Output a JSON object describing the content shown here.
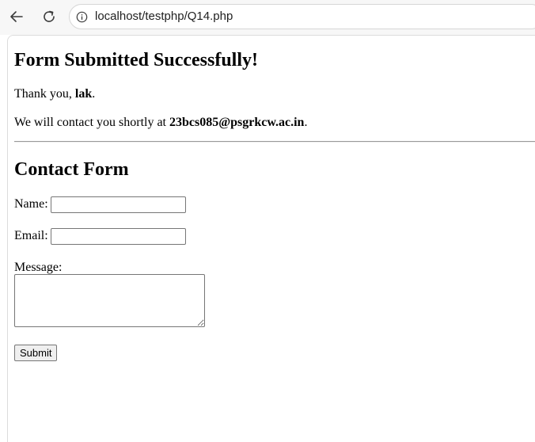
{
  "browser": {
    "url": "localhost/testphp/Q14.php"
  },
  "success": {
    "title": "Form Submitted Successfully!",
    "thank_prefix": "Thank you, ",
    "name": "lak",
    "thank_suffix": ".",
    "contact_prefix": "We will contact you shortly at ",
    "email": "23bcs085@psgrkcw.ac.in",
    "contact_suffix": "."
  },
  "form": {
    "title": "Contact Form",
    "name_label": "Name:",
    "name_value": "",
    "email_label": "Email:",
    "email_value": "",
    "message_label": "Message:",
    "message_value": "",
    "submit_label": "Submit"
  },
  "icons": {
    "back": "back-arrow-icon",
    "reload": "reload-icon",
    "info": "info-icon"
  }
}
